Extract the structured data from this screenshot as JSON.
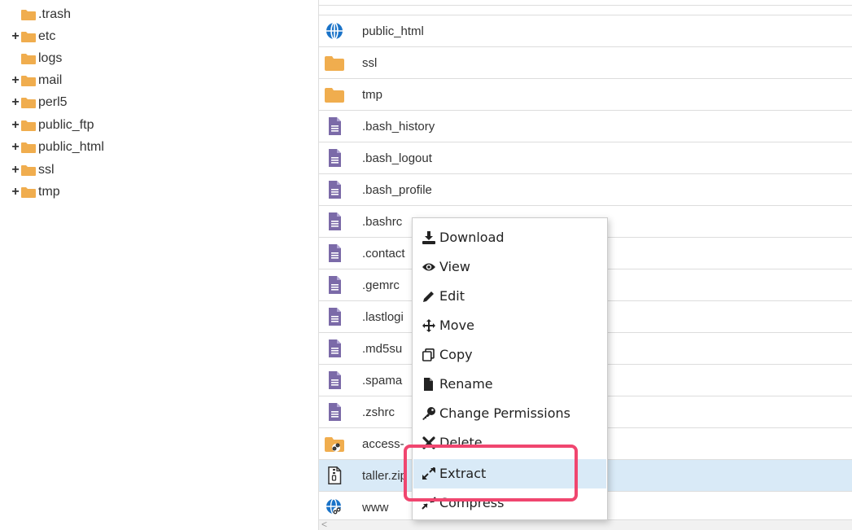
{
  "tree": {
    "items": [
      {
        "label": ".trash",
        "expandable": false
      },
      {
        "label": "etc",
        "expandable": true
      },
      {
        "label": "logs",
        "expandable": false
      },
      {
        "label": "mail",
        "expandable": true
      },
      {
        "label": "perl5",
        "expandable": true
      },
      {
        "label": "public_ftp",
        "expandable": true
      },
      {
        "label": "public_html",
        "expandable": true
      },
      {
        "label": "ssl",
        "expandable": true
      },
      {
        "label": "tmp",
        "expandable": true
      }
    ],
    "expand_symbol": "+",
    "folder_color": "#f0ad4e"
  },
  "files": {
    "rows": [
      {
        "name": "public_html",
        "icon": "globe-icon"
      },
      {
        "name": "ssl",
        "icon": "folder-icon"
      },
      {
        "name": "tmp",
        "icon": "folder-icon"
      },
      {
        "name": ".bash_history",
        "icon": "file-text-icon"
      },
      {
        "name": ".bash_logout",
        "icon": "file-text-icon"
      },
      {
        "name": ".bash_profile",
        "icon": "file-text-icon"
      },
      {
        "name": ".bashrc",
        "icon": "file-text-icon"
      },
      {
        "name": ".contact",
        "icon": "file-text-icon"
      },
      {
        "name": ".gemrc",
        "icon": "file-text-icon"
      },
      {
        "name": ".lastlogi",
        "icon": "file-text-icon"
      },
      {
        "name": ".md5su",
        "icon": "file-text-icon"
      },
      {
        "name": ".spama",
        "icon": "file-text-icon"
      },
      {
        "name": ".zshrc",
        "icon": "file-text-icon"
      },
      {
        "name": "access-",
        "icon": "folder-link-icon"
      },
      {
        "name": "taller.zip",
        "icon": "file-zip-icon",
        "selected": true
      },
      {
        "name": "www",
        "icon": "globe-link-icon"
      }
    ],
    "selected_color": "#d9eaf7",
    "file_icon_color": "#7b6aa8",
    "folder_icon_color": "#f0ad4e",
    "globe_icon_color": "#1a73c8"
  },
  "context_menu": {
    "items": [
      {
        "label": "Download",
        "icon": "download-icon"
      },
      {
        "label": "View",
        "icon": "eye-icon"
      },
      {
        "label": "Edit",
        "icon": "pencil-icon"
      },
      {
        "label": "Move",
        "icon": "move-arrows-icon"
      },
      {
        "label": "Copy",
        "icon": "copy-icon"
      },
      {
        "label": "Rename",
        "icon": "file-icon"
      },
      {
        "label": "Change Permissions",
        "icon": "key-icon"
      },
      {
        "label": "Delete",
        "icon": "x-icon"
      },
      {
        "label": "Extract",
        "icon": "expand-icon",
        "hover": true
      },
      {
        "label": "Compress",
        "icon": "compress-icon"
      }
    ],
    "highlight_color": "#f0466f"
  },
  "scrollbar": {
    "left_arrow": "<"
  }
}
